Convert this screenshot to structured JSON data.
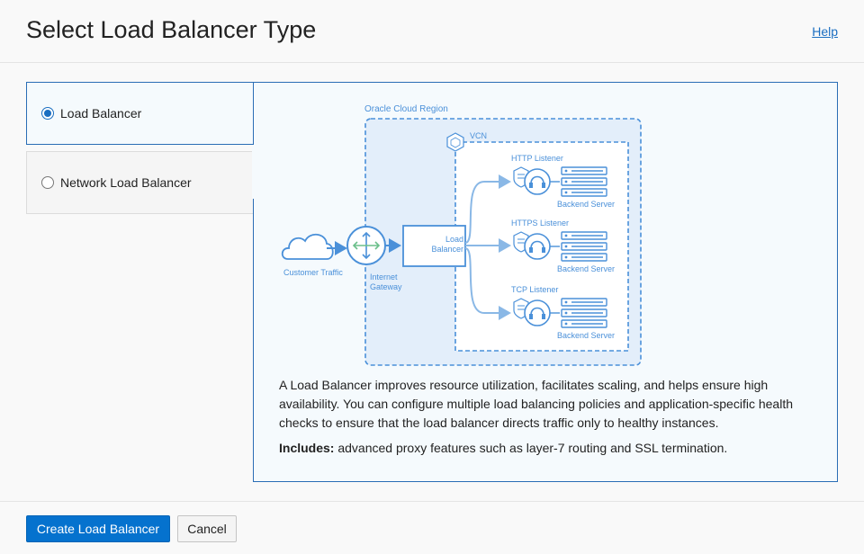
{
  "header": {
    "title": "Select Load Balancer Type",
    "help_label": "Help"
  },
  "options": [
    {
      "label": "Load Balancer",
      "selected": true
    },
    {
      "label": "Network Load Balancer",
      "selected": false
    }
  ],
  "diagram": {
    "region_label": "Oracle Cloud Region",
    "vcn_label": "VCN",
    "customer_traffic": "Customer Traffic",
    "gateway_line1": "Internet",
    "gateway_line2": "Gateway",
    "lb_line1": "Load",
    "lb_line2": "Balancer",
    "listeners": [
      {
        "label": "HTTP Listener",
        "server": "Backend Server"
      },
      {
        "label": "HTTPS Listener",
        "server": "Backend Server"
      },
      {
        "label": "TCP Listener",
        "server": "Backend Server"
      }
    ]
  },
  "description": "A Load Balancer improves resource utilization, facilitates scaling, and helps ensure high availability. You can configure multiple load balancing policies and application-specific health checks to ensure that the load balancer directs traffic only to healthy instances.",
  "includes": {
    "label": "Includes:",
    "text": " advanced proxy features such as layer-7 routing and SSL termination."
  },
  "footer": {
    "create_label": "Create Load Balancer",
    "cancel_label": "Cancel"
  },
  "colors": {
    "accent": "#0572ce",
    "diagram_blue": "#4a90d9",
    "selected_border": "#2a6db5"
  }
}
